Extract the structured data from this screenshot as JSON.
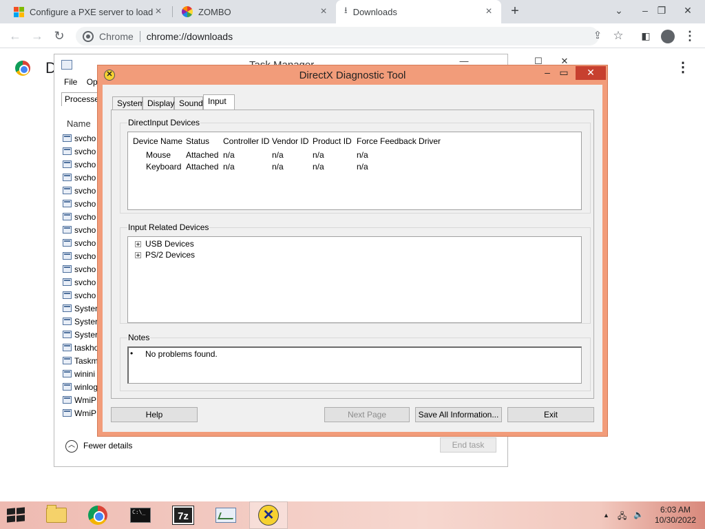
{
  "browser": {
    "tabs": [
      {
        "title": "Configure a PXE server to load W",
        "icon": "microsoft-logo-icon"
      },
      {
        "title": "ZOMBO",
        "icon": "zombo-flower-icon"
      },
      {
        "title": "Downloads",
        "icon": "download-icon"
      }
    ],
    "omnibox": {
      "site": "Chrome",
      "url": "chrome://downloads"
    }
  },
  "downloads_page": {
    "title_initial": "D"
  },
  "task_manager": {
    "title": "Task Manager",
    "menu": [
      "File",
      "Op"
    ],
    "tab_label": "Processe",
    "column_name": "Name",
    "processes": [
      "svcho",
      "svcho",
      "svcho",
      "svcho",
      "svcho",
      "svcho",
      "svcho",
      "svcho",
      "svcho",
      "svcho",
      "svcho",
      "svcho",
      "svcho",
      "Syster",
      "Syster",
      "Syster",
      "taskho",
      "Taskm",
      "winini",
      "winlog",
      "WmiP",
      "WmiP"
    ],
    "fewer_details": "Fewer details",
    "end_task": "End task"
  },
  "dxdiag": {
    "title": "DirectX Diagnostic Tool",
    "tabs": [
      "System",
      "Display",
      "Sound",
      "Input"
    ],
    "active_tab": "Input",
    "directinput": {
      "label": "DirectInput Devices",
      "columns": [
        "Device Name",
        "Status",
        "Controller ID",
        "Vendor ID",
        "Product ID",
        "Force Feedback Driver"
      ],
      "rows": [
        [
          "Mouse",
          "Attached",
          "n/a",
          "n/a",
          "n/a",
          "n/a"
        ],
        [
          "Keyboard",
          "Attached",
          "n/a",
          "n/a",
          "n/a",
          "n/a"
        ]
      ]
    },
    "related": {
      "label": "Input Related Devices",
      "items": [
        "USB Devices",
        "PS/2 Devices"
      ]
    },
    "notes": {
      "label": "Notes",
      "items": [
        "No problems found."
      ]
    },
    "buttons": {
      "help": "Help",
      "next": "Next Page",
      "save": "Save All Information...",
      "exit": "Exit"
    }
  },
  "taskbar": {
    "apps": [
      "file-explorer-icon",
      "chrome-icon",
      "command-prompt-icon",
      "7zip-icon",
      "performance-monitor-icon",
      "directx-icon"
    ],
    "time": "6:03 AM",
    "date": "10/30/2022"
  }
}
